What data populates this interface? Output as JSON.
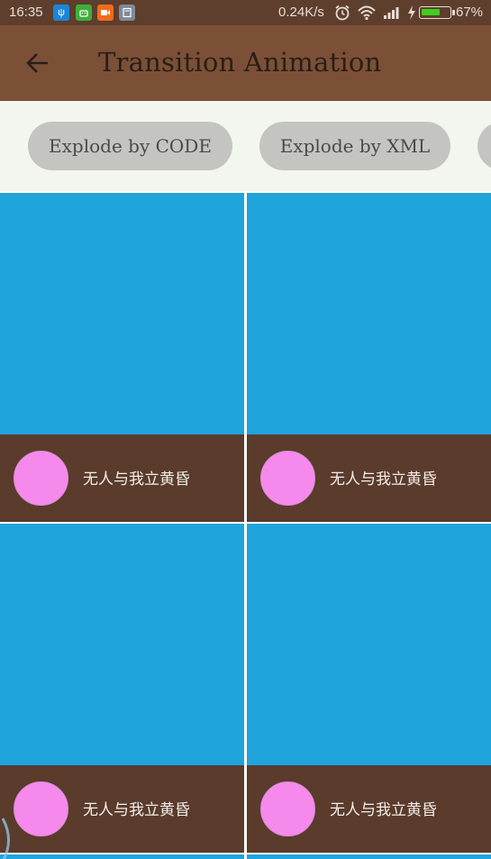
{
  "status_bar": {
    "time": "16:35",
    "network_speed": "0.24K/s",
    "battery_percent": "67%",
    "battery_level": 0.67,
    "notification_icons": [
      "usb-icon",
      "android-icon",
      "video-icon",
      "calculator-icon"
    ],
    "system_icons": [
      "alarm-icon",
      "wifi-icon",
      "signal-icon",
      "charging-icon",
      "battery-icon"
    ]
  },
  "app_bar": {
    "title": "Transition Animation",
    "back_icon": "arrow-left-icon",
    "background": "#7b5037"
  },
  "buttons": [
    {
      "label": "Explode by CODE"
    },
    {
      "label": "Explode by XML"
    },
    {
      "label": ""
    }
  ],
  "grid": {
    "accent": "#1fa4dc",
    "caption_bg": "#5a3b2c",
    "avatar_color": "#f58aec",
    "items": [
      {
        "caption": "无人与我立黄昏"
      },
      {
        "caption": "无人与我立黄昏"
      },
      {
        "caption": "无人与我立黄昏"
      },
      {
        "caption": "无人与我立黄昏"
      }
    ]
  }
}
